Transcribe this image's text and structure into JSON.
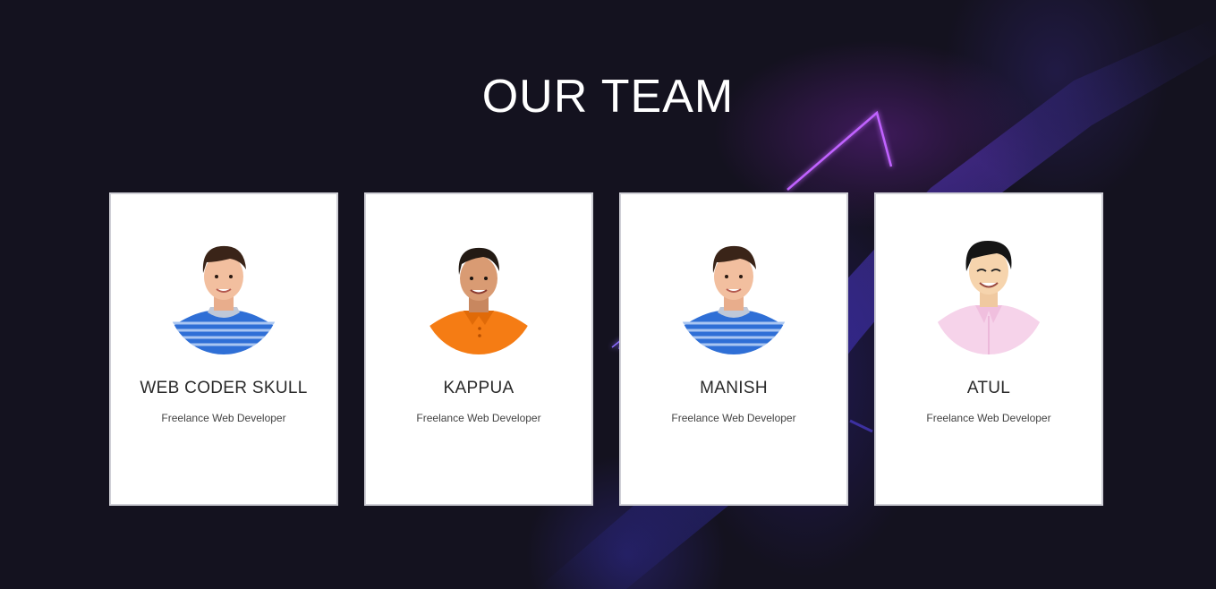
{
  "section": {
    "title": "OUR TEAM"
  },
  "team": [
    {
      "name": "WEB CODER SKULL",
      "role": "Freelance Web Developer",
      "avatar_icon": "man-striped-shirt-icon",
      "shirt_color": "#2f6fd6",
      "hair_color": "#3a2418"
    },
    {
      "name": "KAPPUA",
      "role": "Freelance Web Developer",
      "avatar_icon": "man-orange-polo-icon",
      "shirt_color": "#f57c14",
      "hair_color": "#231a14"
    },
    {
      "name": "MANISH",
      "role": "Freelance Web Developer",
      "avatar_icon": "man-striped-shirt-icon",
      "shirt_color": "#2f6fd6",
      "hair_color": "#3a2418"
    },
    {
      "name": "ATUL",
      "role": "Freelance Web Developer",
      "avatar_icon": "man-pink-shirt-icon",
      "shirt_color": "#f6d3ea",
      "hair_color": "#151515"
    }
  ],
  "colors": {
    "background": "#14121f",
    "card": "#ffffff",
    "accent_glow": "#b34dff"
  }
}
